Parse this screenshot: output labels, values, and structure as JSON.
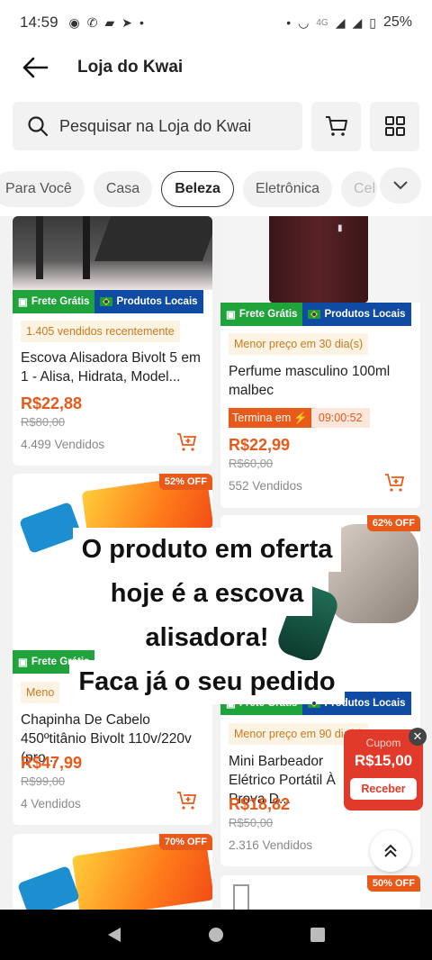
{
  "status": {
    "time": "14:59",
    "battery": "25%",
    "network": "4G"
  },
  "header": {
    "title": "Loja do Kwai"
  },
  "search": {
    "placeholder": "Pesquisar na Loja do Kwai"
  },
  "categories": {
    "items": [
      "Para Você",
      "Casa",
      "Beleza",
      "Eletrônica",
      "Cel"
    ],
    "selected": "Beleza"
  },
  "badges": {
    "free_shipping": "Frete Grátis",
    "local": "Produtos Locais"
  },
  "products": [
    {
      "hint": "1.405 vendidos recentemente",
      "name": "Escova Alisadora Bivolt 5 em 1 - Alisa, Hidrata, Model...",
      "price": "R$22,88",
      "old_price": "R$80,00",
      "sold": "4.499 Vendidos"
    },
    {
      "hint": "Menor preço em 30 dia(s)",
      "name": "Perfume masculino 100ml malbec",
      "timer_label": "Termina em",
      "timer": "09:00:52",
      "price": "R$22,99",
      "old_price": "R$60,00",
      "sold": "552 Vendidos"
    },
    {
      "discount": "52% OFF",
      "hint": "Meno",
      "name": "Chapinha De Cabelo 450ºtitânio Bivolt 110v/220v (pro...",
      "price": "R$47,99",
      "old_price": "R$99,00",
      "sold": "4 Vendidos"
    },
    {
      "discount": "62% OFF",
      "hint": "Menor preço em 90 dia(s)",
      "name": "Mini Barbeador Elétrico Portátil À Prova D...",
      "price": "R$18,82",
      "old_price": "R$50,00",
      "sold": "2.316 Vendidos"
    },
    {
      "discount": "70% OFF"
    },
    {
      "discount": "50% OFF"
    }
  ],
  "overlay_caption": [
    "O produto em oferta",
    "hoje é a escova",
    "alisadora!",
    "Faca já o seu pedido"
  ],
  "coupon": {
    "title": "Cupom",
    "value": "R$15,00",
    "button": "Receber"
  },
  "colors": {
    "accent": "#e8591a",
    "green": "#1fa33a",
    "blue": "#0f4aa3"
  }
}
